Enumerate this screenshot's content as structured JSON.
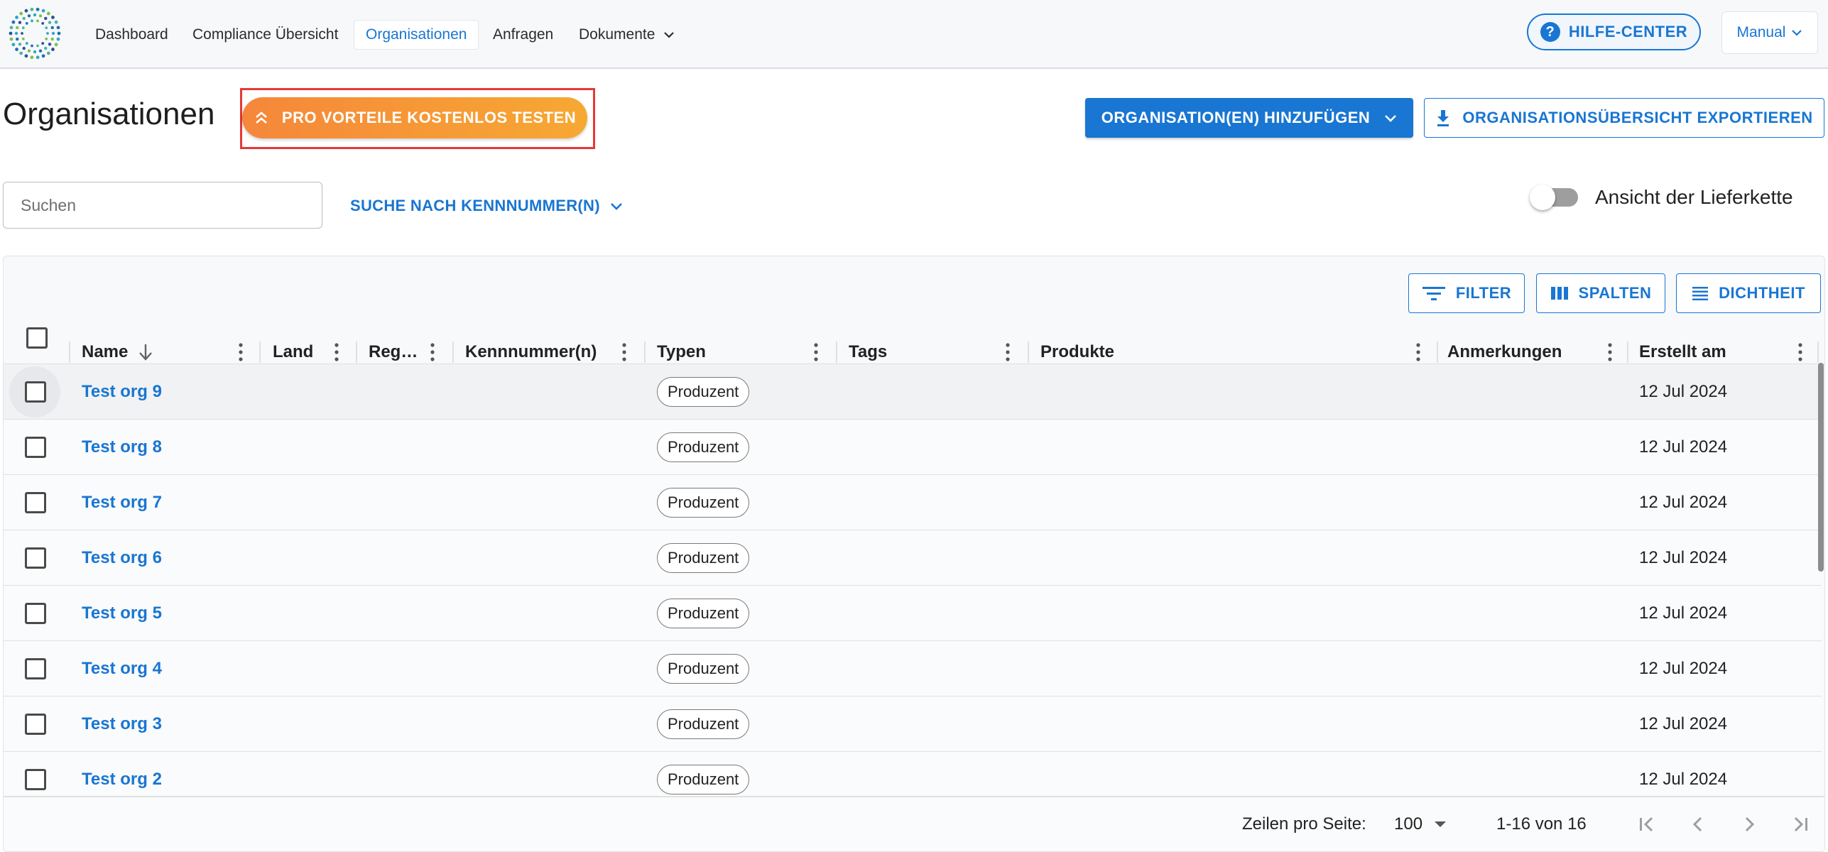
{
  "nav": {
    "items": [
      {
        "label": "Dashboard"
      },
      {
        "label": "Compliance Übersicht"
      },
      {
        "label": "Organisationen"
      },
      {
        "label": "Anfragen"
      },
      {
        "label": "Dokumente"
      }
    ],
    "active": "Organisationen",
    "help_label": "HILFE-CENTER",
    "help_icon": "?",
    "user_menu_label": "Manual"
  },
  "header": {
    "title": "Organisationen",
    "pro_label": "PRO VORTEILE KOSTENLOS TESTEN",
    "add_label": "ORGANISATION(EN) HINZUFÜGEN",
    "export_label": "ORGANISATIONSÜBERSICHT EXPORTIEREN"
  },
  "search": {
    "placeholder": "Suchen",
    "id_search_label": "SUCHE NACH KENNNUMMER(N)",
    "toggle_label": "Ansicht der Lieferkette",
    "toggle_on": false
  },
  "toolbar": {
    "filter_label": "FILTER",
    "columns_label": "SPALTEN",
    "density_label": "DICHTHEIT"
  },
  "table": {
    "columns": [
      "Name",
      "Land",
      "Reg…",
      "Kennnummer(n)",
      "Typen",
      "Tags",
      "Produkte",
      "Anmerkungen",
      "Erstellt am"
    ],
    "rows": [
      {
        "name": "Test org 9",
        "type": "Produzent",
        "created": "12 Jul 2024"
      },
      {
        "name": "Test org 8",
        "type": "Produzent",
        "created": "12 Jul 2024"
      },
      {
        "name": "Test org 7",
        "type": "Produzent",
        "created": "12 Jul 2024"
      },
      {
        "name": "Test org 6",
        "type": "Produzent",
        "created": "12 Jul 2024"
      },
      {
        "name": "Test org 5",
        "type": "Produzent",
        "created": "12 Jul 2024"
      },
      {
        "name": "Test org 4",
        "type": "Produzent",
        "created": "12 Jul 2024"
      },
      {
        "name": "Test org 3",
        "type": "Produzent",
        "created": "12 Jul 2024"
      },
      {
        "name": "Test org 2",
        "type": "Produzent",
        "created": "12 Jul 2024"
      }
    ]
  },
  "pagination": {
    "rows_per_page_label": "Zeilen pro Seite:",
    "rows_per_page": "100",
    "range": "1-16 von 16"
  },
  "colors": {
    "primary": "#1976d2",
    "pro_gradient_start": "#f5873a",
    "pro_gradient_end": "#f7a833",
    "highlight_frame": "#e53935"
  }
}
